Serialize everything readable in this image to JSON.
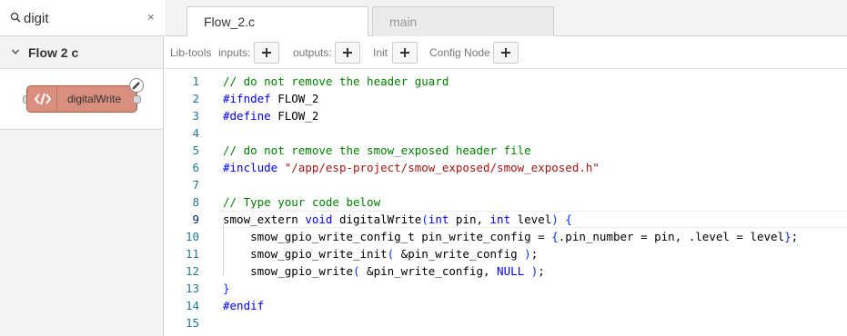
{
  "search": {
    "value": "digit",
    "clear_label": "×"
  },
  "palette": {
    "category": {
      "label": "Flow 2 c"
    },
    "nodes": [
      {
        "label": "digitalWrite"
      }
    ]
  },
  "tabs": [
    {
      "label": "Flow_2.c",
      "active": true
    },
    {
      "label": "main",
      "active": false
    }
  ],
  "toolbar": {
    "lib_tools_label": "Lib-tools",
    "inputs_label": "inputs:",
    "outputs_label": "outputs:",
    "init_label": "Init",
    "config_node_label": "Config Node"
  },
  "editor": {
    "line_numbers": [
      "1",
      "2",
      "3",
      "4",
      "5",
      "6",
      "7",
      "8",
      "9",
      "10",
      "11",
      "12",
      "13",
      "14",
      "15"
    ],
    "current_line": "9",
    "lines": [
      "// do not remove the header guard",
      "#ifndef FLOW_2",
      "#define FLOW_2",
      "",
      "// do not remove the smow_exposed header file",
      "#include \"/app/esp-project/smow_exposed/smow_exposed.h\"",
      "",
      "// Type your code below",
      "smow_extern void digitalWrite(int pin, int level) {",
      "    smow_gpio_write_config_t pin_write_config = {.pin_number = pin, .level = level};",
      "    smow_gpio_write_init( &pin_write_config );",
      "    smow_gpio_write( &pin_write_config, NULL );",
      "}",
      "#endif",
      ""
    ]
  },
  "colors": {
    "node_fill": "#d98f7d",
    "comment": "#008000",
    "keyword": "#0000ff",
    "string": "#a31515",
    "line_number": "#237893"
  },
  "icons": [
    "search-icon",
    "clear-icon",
    "chevron-down-icon",
    "code-icon",
    "edit-icon",
    "plus-icon"
  ]
}
